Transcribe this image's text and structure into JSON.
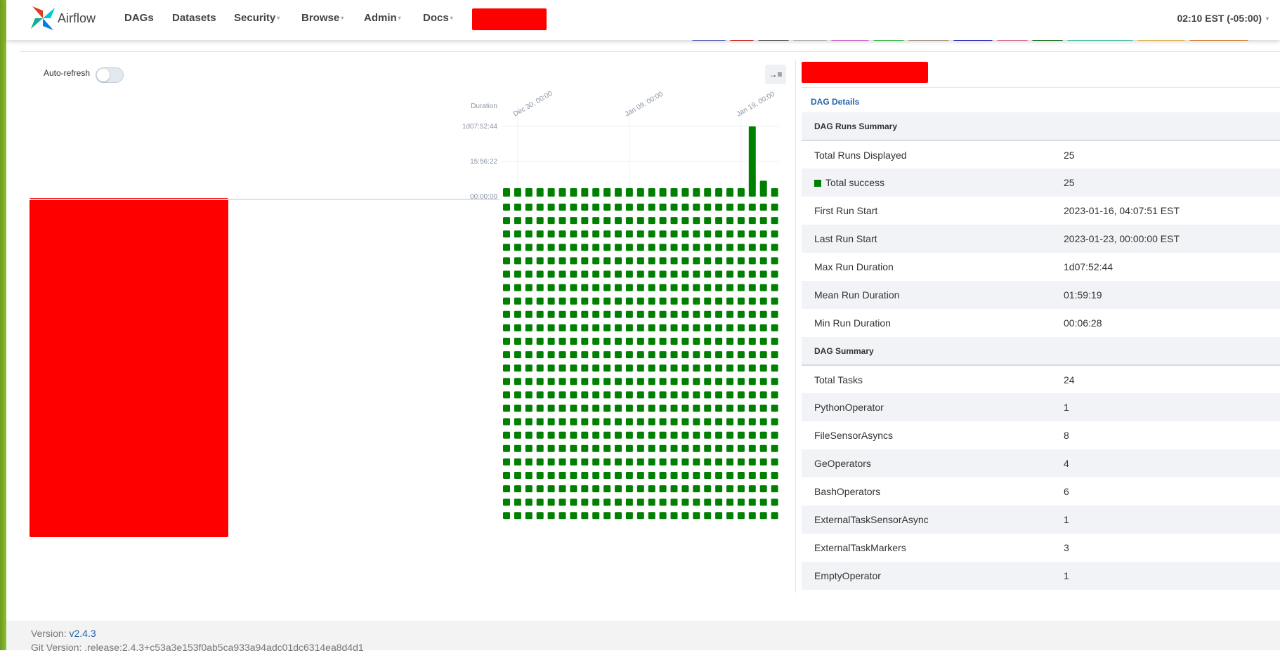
{
  "navbar": {
    "brand": "Airflow",
    "items": [
      {
        "label": "DAGs",
        "dropdown": false
      },
      {
        "label": "Datasets",
        "dropdown": false
      },
      {
        "label": "Security",
        "dropdown": true
      },
      {
        "label": "Browse",
        "dropdown": true
      },
      {
        "label": "Admin",
        "dropdown": true
      },
      {
        "label": "Docs",
        "dropdown": true
      }
    ],
    "clock": "02:10 EST (-05:00)",
    "caret": "▾"
  },
  "state_colors": [
    "#5b5fc7",
    "#e21818",
    "#555555",
    "#c0c0c0",
    "#e565e5",
    "#2ecc40",
    "#b5a086",
    "#1a1ac4",
    "#ef6f9c",
    "#0a6d0a",
    "#43d5c9",
    "#f7c948",
    "#f08a24"
  ],
  "grid": {
    "auto_refresh_label": "Auto-refresh",
    "collapse_icon": "→≡",
    "success_color": "#008000"
  },
  "chart_data": {
    "type": "bar",
    "ylabel": "Duration",
    "y_ticks": [
      "00:00:00",
      "15:56:22",
      "1d07:52:44"
    ],
    "y_max_seconds": 114764,
    "x_ticks": [
      {
        "label": "Dec 30, 00:00",
        "run_index": 1
      },
      {
        "label": "Jan 09, 00:00",
        "run_index": 11
      },
      {
        "label": "Jan 19, 00:00",
        "run_index": 21
      }
    ],
    "run_durations_seconds": [
      7500,
      7500,
      7500,
      7500,
      7500,
      7500,
      7500,
      7500,
      7500,
      7500,
      7500,
      7500,
      7500,
      7500,
      7500,
      7500,
      7500,
      7500,
      7500,
      7500,
      7500,
      7500,
      114764,
      26000,
      7500
    ],
    "task_rows": 24,
    "task_state": "success"
  },
  "details": {
    "tab": "DAG Details",
    "runs_summary_header": "DAG Runs Summary",
    "runs_summary": [
      {
        "key": "Total Runs Displayed",
        "value": "25"
      },
      {
        "key": "Total success",
        "value": "25"
      },
      {
        "key": "First Run Start",
        "value": "2023-01-16, 04:07:51 EST"
      },
      {
        "key": "Last Run Start",
        "value": "2023-01-23, 00:00:00 EST"
      },
      {
        "key": "Max Run Duration",
        "value": "1d07:52:44"
      },
      {
        "key": "Mean Run Duration",
        "value": "01:59:19"
      },
      {
        "key": "Min Run Duration",
        "value": "00:06:28"
      }
    ],
    "dag_summary_header": "DAG Summary",
    "dag_summary": [
      {
        "key": "Total Tasks",
        "value": "24"
      },
      {
        "key": "PythonOperator",
        "value": "1"
      },
      {
        "key": "FileSensorAsyncs",
        "value": "8"
      },
      {
        "key": "GeOperators",
        "value": "4"
      },
      {
        "key": "BashOperators",
        "value": "6"
      },
      {
        "key": "ExternalTaskSensorAsync",
        "value": "1"
      },
      {
        "key": "ExternalTaskMarkers",
        "value": "3"
      },
      {
        "key": "EmptyOperator",
        "value": "1"
      }
    ]
  },
  "footer": {
    "version_label": "Version: ",
    "version": "v2.4.3",
    "git_version": "Git Version: .release:2.4.3+c53a3e153f0ab5ca933a94adc01dc6314ea8d4d1"
  }
}
